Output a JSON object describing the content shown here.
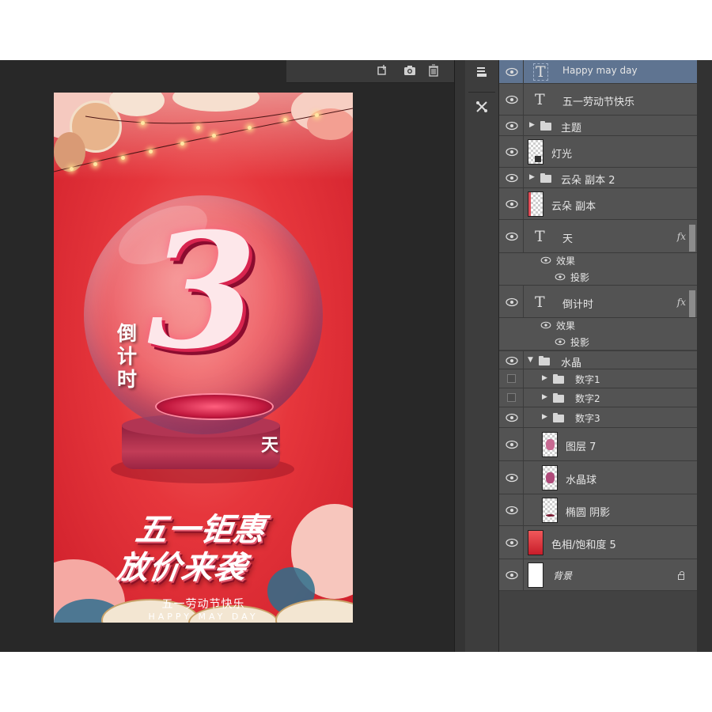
{
  "colors": {
    "workspace": "#262626",
    "panel": "#424242",
    "row": "#535353",
    "selected_row": "#5f7491",
    "text": "#e6e6e6",
    "poster_red": "#e6363c"
  },
  "top_toolbar": {
    "icons": [
      "new-layer-icon",
      "camera-icon",
      "trash-icon"
    ]
  },
  "tools": [
    "layers-panel-icon",
    "tools-cross-icon"
  ],
  "poster": {
    "big_number": "3",
    "countdown": "倒计时",
    "day": "天",
    "slogan_line1": "五一钜惠",
    "slogan_line2": "放价来袭",
    "holiday_cn": "五一劳动节快乐",
    "holiday_en": "HAPPY MAY DAY"
  },
  "layers": [
    {
      "name": "Happy may day",
      "kind": "text",
      "visible": true,
      "selected": true
    },
    {
      "name": "五一劳动节快乐",
      "kind": "text",
      "visible": true
    },
    {
      "name": "主题",
      "kind": "group",
      "visible": true
    },
    {
      "name": "灯光",
      "kind": "smart",
      "visible": true
    },
    {
      "name": "云朵 副本 2",
      "kind": "group",
      "visible": true
    },
    {
      "name": "云朵 副本",
      "kind": "pixel",
      "visible": true
    },
    {
      "name": "天",
      "kind": "text",
      "visible": true,
      "fx": "fx",
      "effects_label": "效果",
      "effect": "投影"
    },
    {
      "name": "倒计时",
      "kind": "text",
      "visible": true,
      "fx": "fx",
      "effects_label": "效果",
      "effect": "投影"
    },
    {
      "name": "水晶",
      "kind": "group-open",
      "visible": true
    },
    {
      "name": "数字1",
      "kind": "group",
      "visible": false
    },
    {
      "name": "数字2",
      "kind": "group",
      "visible": false
    },
    {
      "name": "数字3",
      "kind": "group",
      "visible": true
    },
    {
      "name": "图层 7",
      "kind": "pixel",
      "visible": true
    },
    {
      "name": "水晶球",
      "kind": "pixel",
      "visible": true
    },
    {
      "name": "椭圆 阴影",
      "kind": "pixel",
      "visible": true
    },
    {
      "name": "色相/饱和度 5",
      "kind": "adjust",
      "visible": true
    },
    {
      "name": "背景",
      "kind": "background",
      "visible": true,
      "locked": true
    }
  ]
}
